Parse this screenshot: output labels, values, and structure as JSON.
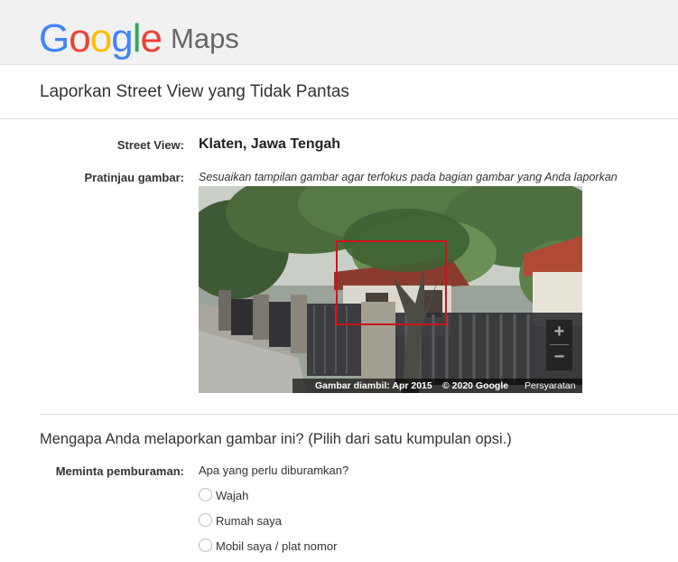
{
  "header": {
    "logo_letters": [
      "G",
      "o",
      "o",
      "g",
      "l",
      "e"
    ],
    "product": "Maps"
  },
  "page_title": "Laporkan Street View yang Tidak Pantas",
  "street_view": {
    "label": "Street View:",
    "location": "Klaten, Jawa Tengah"
  },
  "preview": {
    "label": "Pratinjau gambar:",
    "hint": "Sesuaikan tampilan gambar agar terfokus pada bagian gambar yang Anda laporkan",
    "zoom_in": "+",
    "zoom_out": "−",
    "capture_date": "Gambar diambil: Apr 2015",
    "copyright": "© 2020 Google",
    "terms": "Persyaratan"
  },
  "question": "Mengapa Anda melaporkan gambar ini?  (Pilih dari satu kumpulan opsi.)",
  "blur_request": {
    "label": "Meminta pemburaman:",
    "prompt": "Apa yang perlu diburamkan?",
    "options": [
      "Wajah",
      "Rumah saya",
      "Mobil saya / plat nomor"
    ]
  },
  "colors": {
    "selection_border": "#c9151b",
    "google_blue": "#4285f4",
    "google_red": "#ea4335",
    "google_yellow": "#fbbc05",
    "google_green": "#34a853"
  }
}
